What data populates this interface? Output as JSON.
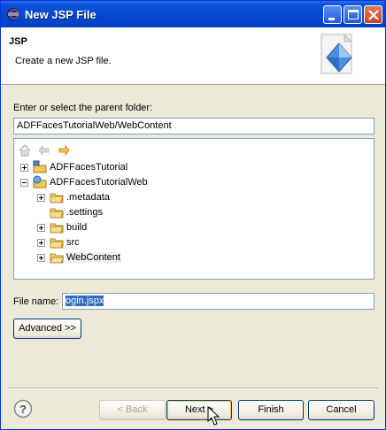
{
  "window": {
    "title": "New JSP File"
  },
  "header": {
    "title": "JSP",
    "description": "Create a new JSP file."
  },
  "folder": {
    "label": "Enter or select the parent folder:",
    "value": "ADFFacesTutorialWeb/WebContent"
  },
  "tree": {
    "items": [
      {
        "label": "ADFFacesTutorial"
      },
      {
        "label": "ADFFacesTutorialWeb"
      },
      {
        "label": ".metadata"
      },
      {
        "label": ".settings"
      },
      {
        "label": "build"
      },
      {
        "label": "src"
      },
      {
        "label": "WebContent"
      }
    ]
  },
  "filename": {
    "label": "File name:",
    "value": "login.jspx",
    "visible_value": "ogin.jspx"
  },
  "buttons": {
    "advanced": "Advanced >>",
    "back": "< Back",
    "next": "Next >",
    "finish": "Finish",
    "cancel": "Cancel"
  },
  "colors": {
    "titlebar": "#0548d0",
    "dialog": "#ece9d8",
    "selection": "#316ac5"
  }
}
